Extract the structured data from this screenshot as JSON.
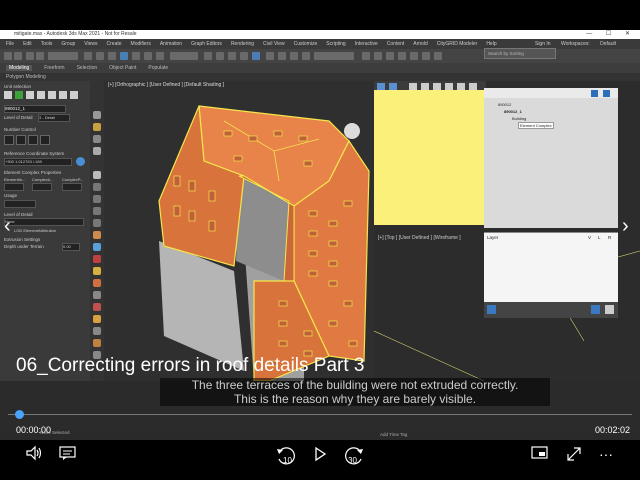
{
  "max": {
    "window_title": "mitigate.max - Autodesk 3ds Max 2021 - Not for Resale",
    "menu": [
      "File",
      "Edit",
      "Tools",
      "Group",
      "Views",
      "Create",
      "Modifiers",
      "Animation",
      "Graph Editors",
      "Rendering",
      "Civil View",
      "Customize",
      "Scripting",
      "Interactive",
      "Content",
      "Arnold",
      "CityGRID Modeler",
      "Help"
    ],
    "sign_in": "Sign In",
    "workspaces_label": "Workspaces:",
    "workspaces_value": "Default",
    "ribbon_tabs": [
      "Modeling",
      "Freeform",
      "Selection",
      "Object Paint",
      "Populate"
    ],
    "subribbon": "Polygon Modeling",
    "left_panel": {
      "unit_selection": "Unit selection",
      "unit_id": "890012_1",
      "level_of_detail": "Level of Detail",
      "lod_value": "3 - Detail",
      "number_control": "Number Control",
      "ref_system": "Reference Coordinate System",
      "ref_value": "+300 1.012763 /.189",
      "element_complex": "Element Complex Properties",
      "ec_cols": [
        "ElementIn...",
        "Complex#...",
        "ComplexP..."
      ],
      "usage": "Usage",
      "lod_label2": "Level of Detail",
      "lod2_value": "None",
      "checkbox_label": "LOD ElementAttribution",
      "extrusion": "Extrusion Settings",
      "depth_label": "Depth under Terrain",
      "depth_value": "0.00"
    },
    "viewport_label": "[+] [Orthographic ] [User Defined ] [Default Shading ]",
    "viewport2_label": "[+] [Top ] [User Defined ] [Wireframe ]",
    "search_placeholder": "Search by Sorting",
    "scene_tree": [
      "890012",
      "890012_1",
      "Building",
      "Element Complex"
    ],
    "layer_header": "Layer",
    "layer_cols": [
      "V",
      "L",
      "R"
    ],
    "status_left": "None Selected",
    "status_hint": "Click and drag to select and move objects",
    "add_time_tag": "Add Time Tag"
  },
  "video": {
    "title": "06_Correcting errors in roof details Part 3",
    "subtitle_line1": "The three terraces of the building were not extruded correctly.",
    "subtitle_line2": "This is the reason why they are barely visible.",
    "current_time": "00:00:00",
    "duration": "00:02:02",
    "progress": 0.0
  },
  "controls": {
    "volume_icon": "volume-icon",
    "captions_icon": "captions-icon",
    "skip_back_label": "10",
    "play_icon": "play-icon",
    "skip_forward_label": "30",
    "miniview_icon": "mini-view-icon",
    "fullscreen_icon": "fullscreen-icon",
    "more_label": "···"
  },
  "colors": {
    "roof": "#e8834a",
    "outline": "#f5e64a",
    "accent": "#4aa3ff",
    "yellow_view": "#fbf07a"
  }
}
